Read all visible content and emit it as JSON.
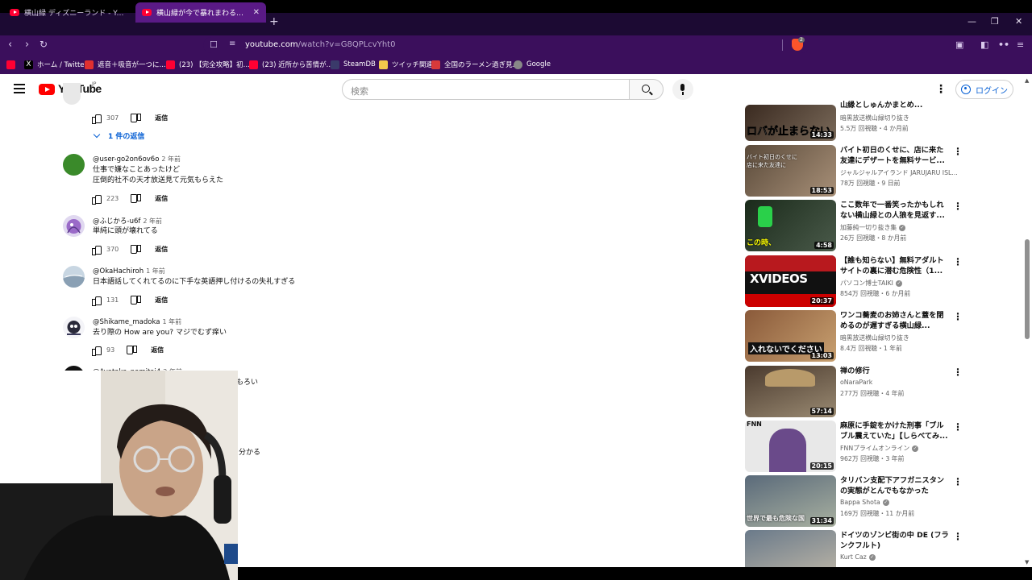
{
  "browser": {
    "tabs": [
      {
        "label": "横山緑 ディズニーランド - YouTube",
        "active": false
      },
      {
        "label": "横山緑が今で暴れまわる【2010/03...",
        "active": true
      }
    ],
    "new_tab": "+",
    "window_controls": {
      "minimize": "—",
      "restore": "❐",
      "close": "✕"
    },
    "url_host": "youtube.com",
    "url_path": "/watch?v=G8QPLcvYht0",
    "brave_badge": "2",
    "bookmarks": [
      {
        "label": "ホーム / Twitter",
        "icon": "x-icon",
        "color": "#000000"
      },
      {
        "label": "遮音＋吸音が一つに...",
        "icon": "red-square-icon",
        "color": "#e03030"
      },
      {
        "label": "(23) 【完全攻略】初...",
        "icon": "youtube-icon",
        "color": "#ff0033"
      },
      {
        "label": "(23) 近所から苦情が...",
        "icon": "youtube-icon",
        "color": "#ff0033"
      },
      {
        "label": "SteamDB",
        "icon": "steamdb-icon",
        "color": "#3a3a6a"
      },
      {
        "label": "ツイッチ関連",
        "icon": "folder-icon",
        "color": "#f2c94c"
      },
      {
        "label": "全国のラーメン過ぎ見...",
        "icon": "ramen-icon",
        "color": "#d83a3a"
      },
      {
        "label": "Google",
        "icon": "globe-icon",
        "color": "#888888"
      }
    ]
  },
  "youtube": {
    "logo_text": "YouTube",
    "region": "JP",
    "search_placeholder": "検索",
    "login_label": "ログイン"
  },
  "comments": {
    "first_likes": "307",
    "replies_toggle": "1 件の返信",
    "reply_label": "返信",
    "items": [
      {
        "author": "@user-go2on6ov6o",
        "ago": "2 年前",
        "lines": [
          "仕事で嫌なことあったけど",
          "圧倒的社不の天才放送見て元気もらえた"
        ],
        "likes": "223",
        "avatar_color": "#3a8a2a"
      },
      {
        "author": "@ふじかろ-u6f",
        "ago": "2 年前",
        "lines": [
          "単純に頭が壊れてる"
        ],
        "likes": "370",
        "avatar_color": "#9a6ac8"
      },
      {
        "author": "@OkaHachiroh",
        "ago": "1 年前",
        "lines": [
          "日本語話してくれてるのに下手な英語押し付けるの失礼すぎる"
        ],
        "likes": "131",
        "avatar_color": "#9fb8cc"
      },
      {
        "author": "@Shikame_madoka",
        "ago": "1 年前",
        "lines": [
          "去り際の How are you? マジでむず痒い"
        ],
        "likes": "93",
        "avatar_color": "#e8e8f0"
      }
    ],
    "partial_author": "@Ayataka_nomitai4",
    "partial_ago": "2 年前",
    "partial_text_1": "もろい",
    "partial_text_2": "く分かる"
  },
  "recommendations": [
    {
      "title": "山縁としゅんかまとめ...",
      "channel": "暗黒放送横山緑切り抜き",
      "verified": false,
      "stats": "5.5万 回視聴・4 か月前",
      "duration": "14:33",
      "thumb_text": "ロバが止まらない",
      "thumb_color": "#5a4a3a"
    },
    {
      "title": "バイト初日のくせに、店に来た友達にデザートを無料サービ...",
      "channel": "ジャルジャルアイランド JARUJARU ISL...",
      "verified": false,
      "stats": "78万 回視聴・9 日前",
      "duration": "18:53",
      "thumb_text": "バイト初日のくせに店に来た友達に",
      "thumb_color": "#6a5a48"
    },
    {
      "title": "ここ数年で一番笑ったかもしれない横山緑との人狼を見返す...",
      "channel": "加藤純一切り抜き集",
      "verified": true,
      "stats": "26万 回視聴・8 か月前",
      "duration": "4:58",
      "thumb_text": "この時、",
      "thumb_color": "#2a3a2a"
    },
    {
      "title": "【誰も知らない】無料アダルトサイトの裏に潜む危険性（1...",
      "channel": "パソコン博士TAIKI",
      "verified": true,
      "stats": "854万 回視聴・6 か月前",
      "duration": "20:37",
      "thumb_text": "XVIDEOS",
      "thumb_color": "#1a1a1a"
    },
    {
      "title": "ワンコ蕎麦のお姉さんと蓋を閉めるのが遅すぎる横山緑...",
      "channel": "暗黒放送横山緑切り抜き",
      "verified": false,
      "stats": "8.4万 回視聴・1 年前",
      "duration": "13:03",
      "thumb_text": "入れないでください",
      "thumb_color": "#8a5a3a"
    },
    {
      "title": "禅の修行",
      "channel": "oNaraPark",
      "verified": false,
      "stats": "277万 回視聴・4 年前",
      "duration": "57:14",
      "thumb_text": "",
      "thumb_color": "#6a5a4a"
    },
    {
      "title": "麻原に手錠をかけた刑事「ブルブル震えていた」【しらべてみ...",
      "channel": "FNNプライムオンライン",
      "verified": true,
      "stats": "962万 回視聴・3 年前",
      "duration": "20:15",
      "thumb_text": "FNN",
      "thumb_color": "#dcdcdc"
    },
    {
      "title": "タリバン支配下アフガニスタンの実態がとんでもなかった",
      "channel": "Bappa Shota",
      "verified": true,
      "stats": "169万 回視聴・11 か月前",
      "duration": "31:34",
      "thumb_text": "世界で最も危険な国",
      "thumb_color": "#7a8a9a"
    },
    {
      "title": "ドイツのゾンビ街の中 DE (フランクフルト)",
      "channel": "Kurt Caz",
      "verified": true,
      "stats": "",
      "duration": "",
      "thumb_text": "",
      "thumb_color": "#8a9aaa"
    }
  ]
}
